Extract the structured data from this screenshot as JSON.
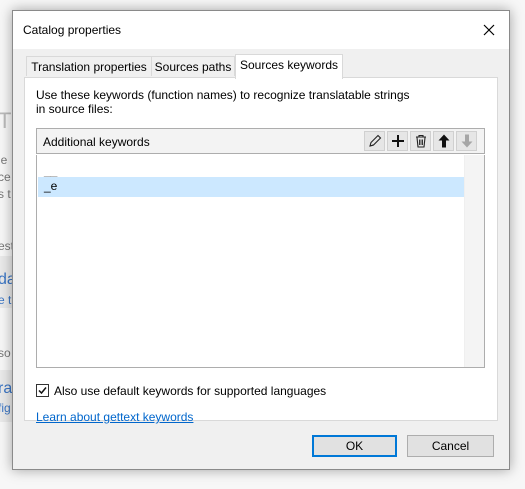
{
  "background": {
    "fragments": [
      "Th",
      "le",
      "ce",
      "s t",
      "est",
      "da",
      "e tr",
      "so",
      "ra",
      "fig"
    ]
  },
  "dialog": {
    "title": "Catalog properties",
    "close_icon": "close-icon",
    "tabs": [
      {
        "label": "Translation properties",
        "active": false
      },
      {
        "label": "Sources paths",
        "active": false
      },
      {
        "label": "Sources keywords",
        "active": true
      }
    ],
    "description": "Use these keywords (function names) to recognize translatable strings in source files:",
    "keywords_header": "Additional keywords",
    "toolbar_icons": [
      "edit-icon",
      "add-icon",
      "delete-icon",
      "move-up-icon",
      "move-down-icon"
    ],
    "keywords": [
      {
        "value": "__",
        "selected": false
      },
      {
        "value": "_e",
        "selected": true
      }
    ],
    "default_keywords_checkbox": {
      "label": "Also use default keywords for supported languages",
      "checked": true
    },
    "help_link": "Learn about gettext keywords",
    "ok_label": "OK",
    "cancel_label": "Cancel",
    "accent_color": "#0078d7",
    "selection_color": "#cce8ff"
  }
}
